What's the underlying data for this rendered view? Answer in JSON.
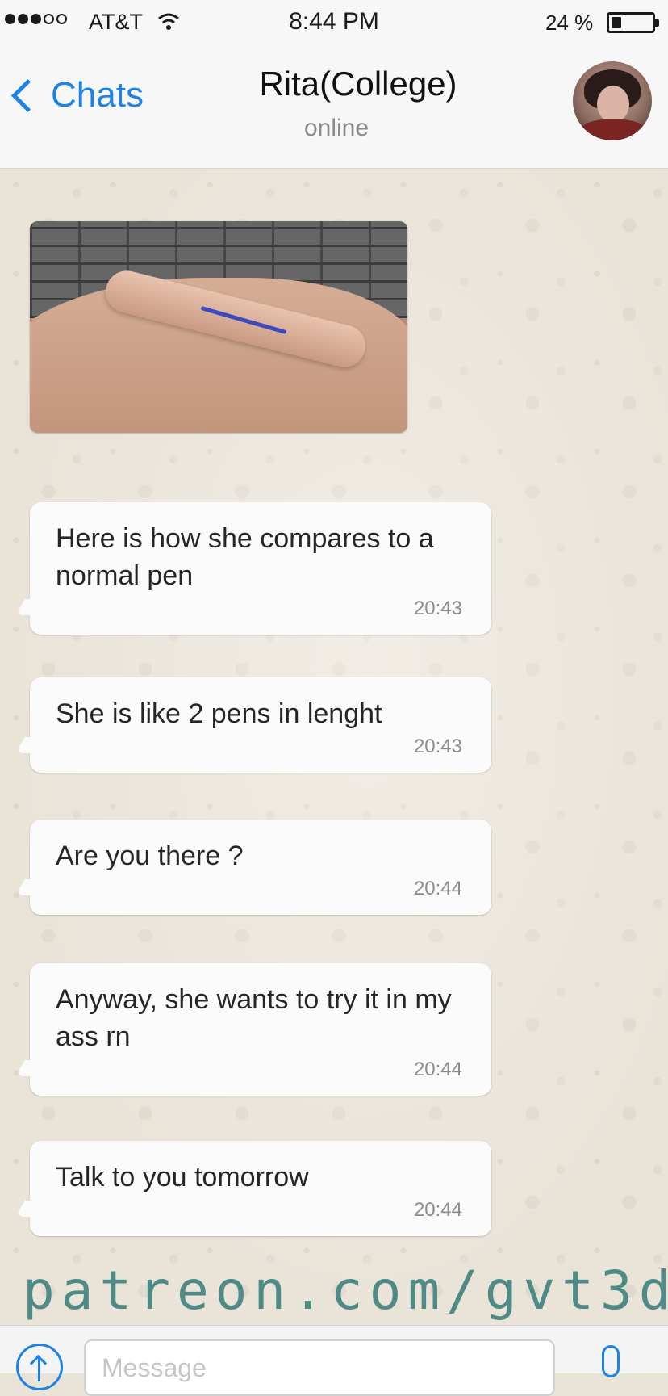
{
  "status_bar": {
    "signal_full": 3,
    "signal_total": 5,
    "carrier": "AT&T",
    "time": "8:44 PM",
    "battery_label": "24 %",
    "battery_level": 0.24
  },
  "header": {
    "back_label": "Chats",
    "contact_name": "Rita(College)",
    "contact_status": "online"
  },
  "messages": [
    {
      "text": "Here is how she compares to a normal pen",
      "time": "20:43"
    },
    {
      "text": "She is like 2 pens in lenght",
      "time": "20:43"
    },
    {
      "text": "Are you there ?",
      "time": "20:44"
    },
    {
      "text": "Anyway, she wants to try it in my ass rn",
      "time": "20:44"
    },
    {
      "text": "Talk to you tomorrow",
      "time": "20:44"
    }
  ],
  "watermark": "patreon.com/gvt3d",
  "input": {
    "placeholder": "Message",
    "value": ""
  },
  "colors": {
    "accent": "#1d82e8",
    "watermark": "#4e8a86",
    "bubble": "#fbfbfb",
    "chat_background": "#e9e3d8"
  }
}
